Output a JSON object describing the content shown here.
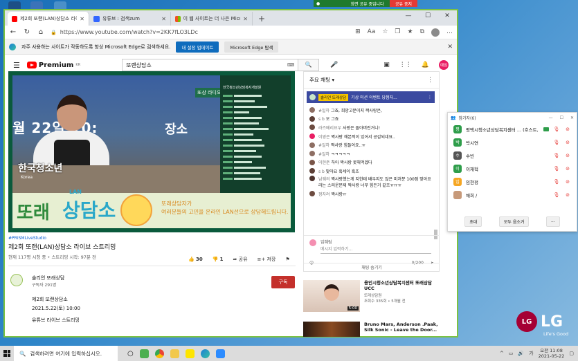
{
  "share": {
    "label": "화면 공유 중입니다",
    "stop": "공유 중지"
  },
  "tabs": [
    {
      "label": "제2회 또랜(LAN)상담소 라이브",
      "color": "#ff0000"
    },
    {
      "label": "유튜브 : 검색zum",
      "color": "#3366ff"
    },
    {
      "label": "이 웹 사이트는 더 나은 Microsof",
      "color": "#f25022"
    }
  ],
  "address": {
    "url": "https://www.youtube.com/watch?v=2KK7fLO3LDc"
  },
  "infobar": {
    "text": "자주 사용하는 사이트가 작동하도록 항상 Microsoft Edge로 검색하세요.",
    "primary": "내 설정 업데이트",
    "secondary": "Microsoft Edge 탐색"
  },
  "yt": {
    "brand": "Premium",
    "region": "KR",
    "query": "또랜상담소",
    "user": "예임"
  },
  "video": {
    "date_text": "월 22일 10:",
    "place_text": "장소",
    "host_label": "한국청소년",
    "korea": "Korea",
    "org": "한국청소년상담복지개발원",
    "big1": "또래",
    "big2": "상담소",
    "lan": "LAN",
    "slogan1": "또래상담자가",
    "slogan2": "여러분들의 고민을 온라인 LAN선으로 상담해드립니다.",
    "radio": "또상 라디오",
    "hashtag": "#PRISMLiveStudio",
    "title": "제2회 또랜(LAN)상담소 라이브 스트리밍",
    "meta": "현재 117명 시청 중 • 스트리밍 시작: 97분 전",
    "likes": "30",
    "dislikes": "1",
    "share": "공유",
    "save": "저장"
  },
  "channel": {
    "name": "솔리언 또래상담",
    "subs": "구독자 291명",
    "subscribe": "구독"
  },
  "description": [
    "제2회 또랜상담소",
    "2021.5.22(토) 10:00",
    "유튜브 라이브 스트리밍"
  ],
  "chat": {
    "header": "주요 채팅",
    "pinned_tag": "솔리언 또래상담",
    "pinned_text": "기상 미션 이벤트 당첨자...",
    "messages": [
      {
        "name": "#일하",
        "text": "그죠, 희망고문이지 짝사랑은,",
        "color": "#8d6e63"
      },
      {
        "name": "s b",
        "text": "오 그죠",
        "color": "#5d4037"
      },
      {
        "name": "라즈베리요우",
        "text": "사랑은 돌아버린거니!",
        "color": "#6d4c41"
      },
      {
        "name": "이영은",
        "text": "짝사랑 해본적이 있어서 공감되네요..",
        "color": "#e91e63"
      },
      {
        "name": "#일하",
        "text": "짝사랑 힘들어요..ㅠ",
        "color": "#8d6e63"
      },
      {
        "name": "#일하",
        "text": "ㅋㅋㅋㅋㅋ",
        "color": "#8d6e63"
      },
      {
        "name": "이현준",
        "text": "하아 짝사랑 못해먹겠다",
        "color": "#795548"
      },
      {
        "name": "s b",
        "text": "맞아요 흑세이 흑조",
        "color": "#5d4037"
      },
      {
        "name": "남궤의",
        "text": "짝사랑했는게 지한테 배우지도 않은 미처분 100점 맞아요라는 스러운문제 짝사랑 너무 힘든거 같조ㅠㅠㅠ",
        "color": "#4e342e"
      },
      {
        "name": "정자려",
        "text": "짝사랑ㅠ",
        "color": "#6d4c41"
      }
    ],
    "input_name": "임혜림",
    "input_placeholder": "메시지 입력하기...",
    "counter": "0/200",
    "hide": "채팅 숨기기"
  },
  "recs": [
    {
      "title": "용인시청소년상담복지센터 또래상담 UCC",
      "channel": "또래상담원",
      "views": "조회수 335회 • 5개월 전",
      "duration": "5:00"
    },
    {
      "title": "Bruno Mars, Anderson .Paak, Silk Sonic - Leave the Door...",
      "channel": "",
      "views": "",
      "duration": ""
    }
  ],
  "participants": {
    "title": "참가자(6)",
    "list": [
      {
        "initial": "평",
        "name": "평택시청소년상담복지센터 ... (호스트, 나)",
        "color": "#2e9d4a"
      },
      {
        "initial": "박",
        "name": "박시연",
        "color": "#2e9d4a"
      },
      {
        "initial": "수",
        "name": "수빈",
        "color": "#555"
      },
      {
        "initial": "이",
        "name": "이재혁",
        "color": "#2e9d4a"
      },
      {
        "initial": "임",
        "name": "임현정",
        "color": "#f5a623"
      },
      {
        "initial": "",
        "name": "채희 /",
        "color": "#c79a7a"
      }
    ],
    "invite": "초대",
    "mute_all": "모두 음소거",
    "more": "..."
  },
  "lg": {
    "brand": "LG",
    "slogan": "Life's Good"
  },
  "taskbar": {
    "search": "검색하려면 여기에 입력하십시오.",
    "time": "오전 11:08",
    "date": "2021-05-22",
    "lang": "가"
  }
}
